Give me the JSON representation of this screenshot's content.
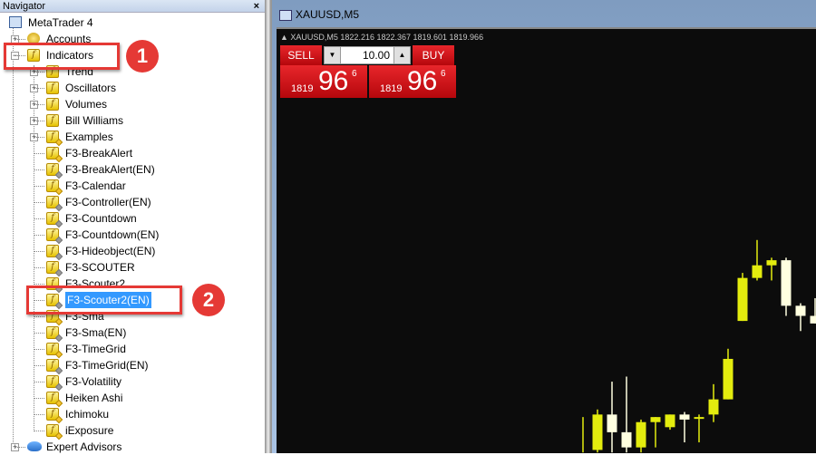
{
  "navigator": {
    "title": "Navigator",
    "close_label": "×",
    "root": "MetaTrader 4",
    "accounts": "Accounts",
    "indicators": "Indicators",
    "groups": [
      "Trend",
      "Oscillators",
      "Volumes",
      "Bill Williams",
      "Examples"
    ],
    "items": [
      {
        "label": "F3-BreakAlert",
        "mark": "gold"
      },
      {
        "label": "F3-BreakAlert(EN)",
        "mark": "gray"
      },
      {
        "label": "F3-Calendar",
        "mark": "gold"
      },
      {
        "label": "F3-Controller(EN)",
        "mark": "gray"
      },
      {
        "label": "F3-Countdown",
        "mark": "gray"
      },
      {
        "label": "F3-Countdown(EN)",
        "mark": "gray"
      },
      {
        "label": "F3-Hideobject(EN)",
        "mark": "gray"
      },
      {
        "label": "F3-SCOUTER",
        "mark": "gray"
      },
      {
        "label": "F3-Scouter2",
        "mark": "gray"
      },
      {
        "label": "F3-Scouter2(EN)",
        "mark": "gray",
        "selected": true
      },
      {
        "label": "F3-Sma",
        "mark": "gold"
      },
      {
        "label": "F3-Sma(EN)",
        "mark": "gray"
      },
      {
        "label": "F3-TimeGrid",
        "mark": "gold"
      },
      {
        "label": "F3-TimeGrid(EN)",
        "mark": "gray"
      },
      {
        "label": "F3-Volatility",
        "mark": "gray"
      },
      {
        "label": "Heiken Ashi",
        "mark": "gold"
      },
      {
        "label": "Ichimoku",
        "mark": "gold"
      },
      {
        "label": "iExposure",
        "mark": "gold"
      }
    ],
    "expert_advisors": "Expert Advisors"
  },
  "callouts": {
    "one": "1",
    "two": "2"
  },
  "chart": {
    "window_title": "XAUUSD,M5",
    "ohlc_line": "▲ XAUUSD,M5  1822.216 1822.367 1819.601 1819.966",
    "sell_label": "SELL",
    "buy_label": "BUY",
    "lots": "10.00",
    "sell_price": {
      "prefix": "1819",
      "big": "96",
      "sup": "6"
    },
    "buy_price": {
      "prefix": "1819",
      "big": "96",
      "sup": "6"
    },
    "colors": {
      "bull": "#e3ec0e",
      "bear": "#ffffe0",
      "background": "#0c0c0c"
    },
    "candles": [
      {
        "o": 1812.0,
        "h": 1812.9,
        "l": 1811.5,
        "c": 1812.0,
        "dir": "wick"
      },
      {
        "o": 1811.6,
        "h": 1813.2,
        "l": 1811.5,
        "c": 1813.0
      },
      {
        "o": 1813.0,
        "h": 1814.3,
        "l": 1811.5,
        "c": 1812.3
      },
      {
        "o": 1812.3,
        "h": 1814.5,
        "l": 1811.5,
        "c": 1811.7
      },
      {
        "o": 1811.7,
        "h": 1812.8,
        "l": 1811.5,
        "c": 1812.7
      },
      {
        "o": 1812.7,
        "h": 1812.9,
        "l": 1811.7,
        "c": 1812.9
      },
      {
        "o": 1812.5,
        "h": 1813.0,
        "l": 1812.4,
        "c": 1813.0
      },
      {
        "o": 1813.0,
        "h": 1813.1,
        "l": 1811.9,
        "c": 1812.8
      },
      {
        "o": 1812.85,
        "h": 1813.0,
        "l": 1811.9,
        "c": 1812.9
      },
      {
        "o": 1813.0,
        "h": 1814.2,
        "l": 1812.7,
        "c": 1813.6
      },
      {
        "o": 1813.6,
        "h": 1815.6,
        "l": 1813.6,
        "c": 1815.2
      },
      {
        "o": 1816.7,
        "h": 1818.6,
        "l": 1816.7,
        "c": 1818.4
      },
      {
        "o": 1818.4,
        "h": 1819.9,
        "l": 1818.3,
        "c": 1818.9
      },
      {
        "o": 1818.9,
        "h": 1819.2,
        "l": 1818.3,
        "c": 1819.1
      },
      {
        "o": 1819.1,
        "h": 1819.2,
        "l": 1816.9,
        "c": 1817.3
      },
      {
        "o": 1817.3,
        "h": 1817.4,
        "l": 1816.3,
        "c": 1816.9
      },
      {
        "o": 1816.9,
        "h": 1817.6,
        "l": 1816.6,
        "c": 1816.6
      }
    ]
  }
}
